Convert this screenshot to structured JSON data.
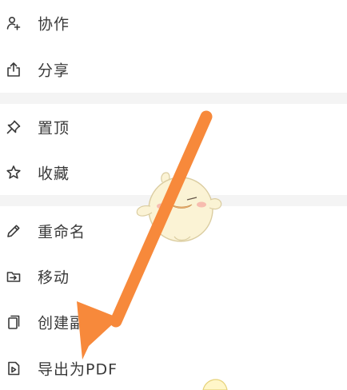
{
  "menu": {
    "group1": [
      {
        "label": "协作",
        "icon": "collaborate-icon"
      },
      {
        "label": "分享",
        "icon": "share-icon"
      }
    ],
    "group2": [
      {
        "label": "置顶",
        "icon": "pin-icon"
      },
      {
        "label": "收藏",
        "icon": "star-icon"
      }
    ],
    "group3": [
      {
        "label": "重命名",
        "icon": "pencil-icon"
      },
      {
        "label": "移动",
        "icon": "folder-move-icon"
      },
      {
        "label": "创建副本",
        "icon": "copy-icon"
      },
      {
        "label": "导出为PDF",
        "icon": "pdf-export-icon"
      }
    ]
  },
  "colors": {
    "text": "#3a3a3a",
    "divider": "#f4f4f4",
    "arrow": "#f7893b",
    "sticker_body": "#fbf3d2"
  },
  "overlay": {
    "arrow_icon": "annotation-arrow-icon",
    "sticker_icon": "chick-sticker-icon"
  }
}
